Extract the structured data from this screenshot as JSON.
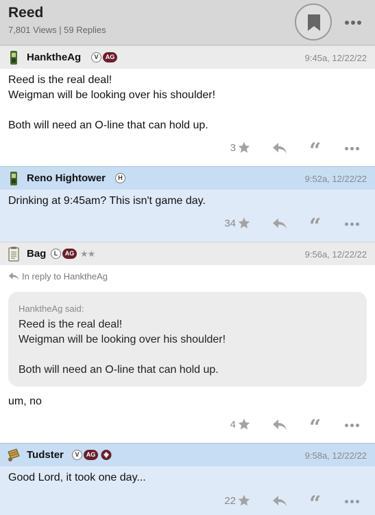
{
  "thread": {
    "title": "Reed",
    "stats": "7,801 Views | 59 Replies"
  },
  "icons": {
    "bookmark": "bookmark-icon",
    "more": "ellipsis-icon",
    "star": "star-icon",
    "reply": "reply-arrow-icon",
    "quote": "quote-icon"
  },
  "colors": {
    "highlight_header": "#c7ddf4",
    "highlight_body": "#dfeaf8",
    "ag_badge": "#6b1e2c"
  },
  "posts": [
    {
      "user": "HanktheAg",
      "badges": [
        "V",
        "AG"
      ],
      "time": "9:45a, 12/22/22",
      "lines": [
        "Reed is the real deal!",
        "Weigman will be looking over his shoulder!",
        "Both will need an O-line that can hold up."
      ],
      "stars": "3"
    },
    {
      "user": "Reno Hightower",
      "badges": [
        "H"
      ],
      "time": "9:52a, 12/22/22",
      "lines": [
        "Drinking at 9:45am? This isn't game day."
      ],
      "stars": "34"
    },
    {
      "user": "Bag",
      "badges": [
        "L",
        "AG"
      ],
      "rank_stars": "★★",
      "time": "9:56a, 12/22/22",
      "in_reply_to": "In reply to HanktheAg",
      "quote": {
        "said": "HanktheAg said:",
        "lines": [
          "Reed is the real deal!",
          "Weigman will be looking over his shoulder!",
          "Both will need an O-line that can hold up."
        ]
      },
      "lines": [
        "um, no"
      ],
      "stars": "4"
    },
    {
      "user": "Tudster",
      "badges": [
        "V",
        "AG"
      ],
      "time": "9:58a, 12/22/22",
      "lines": [
        "Good Lord, it took one day..."
      ],
      "stars": "22"
    }
  ],
  "quote_glyph": "“"
}
